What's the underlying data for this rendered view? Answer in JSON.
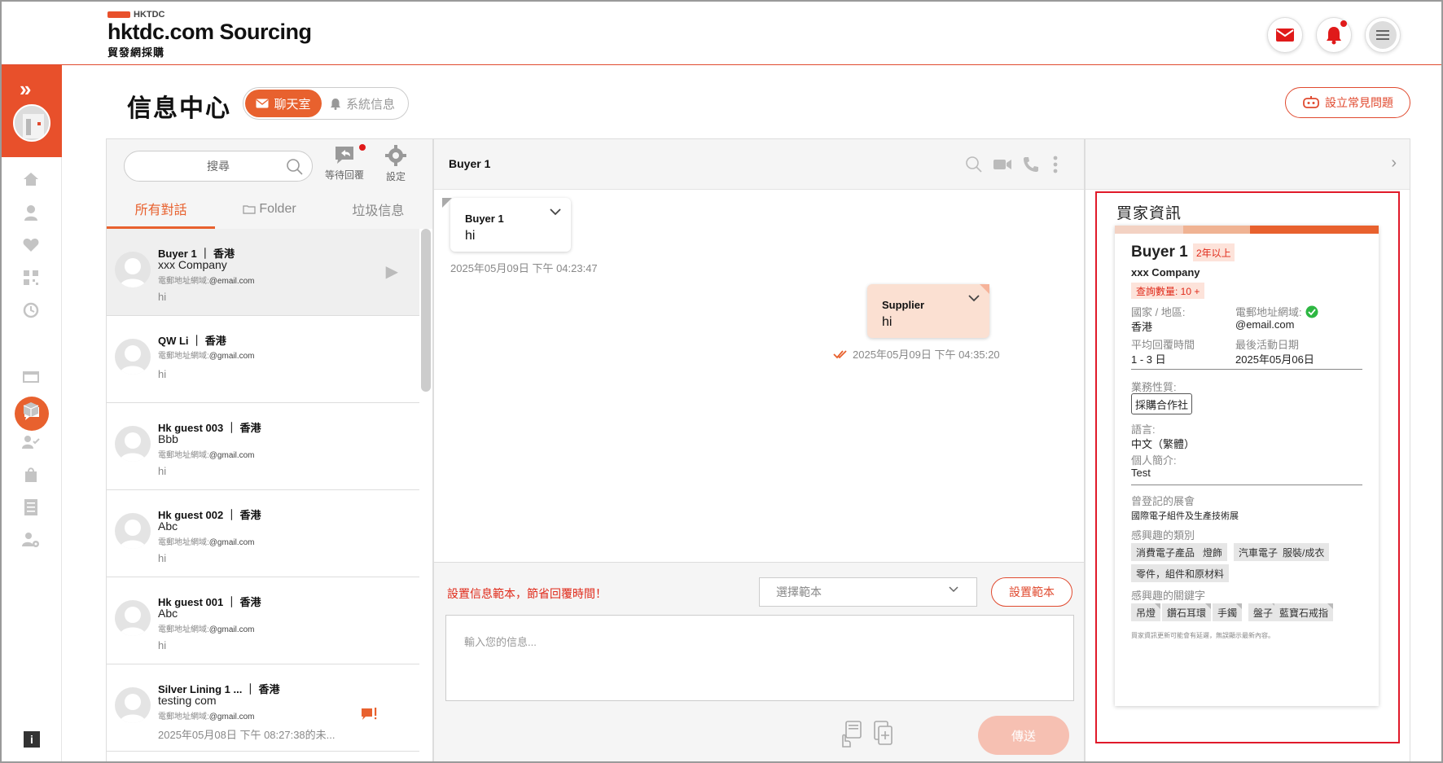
{
  "header": {
    "logo_small": "HKTDC",
    "logo_main": "hktdc.com Sourcing",
    "logo_sub": "貿發網採購"
  },
  "page": {
    "title": "信息中心",
    "tab_chat": "聊天室",
    "tab_system": "系統信息",
    "faq_button": "設立常見問題"
  },
  "list_panel": {
    "search_placeholder": "搜尋",
    "awaiting_reply": "等待回覆",
    "settings": "設定",
    "tabs": [
      "所有對話",
      "Folder",
      "垃圾信息"
    ],
    "email_domain_label": "電郵地址網域:",
    "conversations": [
      {
        "name": "Buyer 1",
        "region": "香港",
        "company": "xxx Company",
        "email": "@email.com",
        "message": "hi"
      },
      {
        "name": "QW Li",
        "region": "香港",
        "company": "",
        "email": "@gmail.com",
        "message": "hi"
      },
      {
        "name": "Hk guest 003",
        "region": "香港",
        "company": "Bbb",
        "email": "@gmail.com",
        "message": "hi"
      },
      {
        "name": "Hk guest 002",
        "region": "香港",
        "company": "Abc",
        "email": "@gmail.com",
        "message": "hi"
      },
      {
        "name": "Hk guest 001",
        "region": "香港",
        "company": "Abc",
        "email": "@gmail.com",
        "message": "hi"
      },
      {
        "name": "Silver Lining 1 ...",
        "region": "香港",
        "company": "testing com",
        "email": "@gmail.com",
        "message": "2025年05月08日 下午 08:27:38的未..."
      }
    ]
  },
  "chat": {
    "title": "Buyer 1",
    "messages": [
      {
        "sender": "Buyer 1",
        "text": "hi",
        "time": "2025年05月09日 下午 04:23:47"
      },
      {
        "sender": "Supplier",
        "text": "hi",
        "time": "2025年05月09日 下午 04:35:20"
      }
    ],
    "template_hint": "設置信息範本，節省回覆時間！",
    "template_select": "選擇範本",
    "template_button": "設置範本",
    "input_placeholder": "輸入您的信息...",
    "send": "傳送"
  },
  "buyer_info": {
    "title": "買家資訊",
    "name": "Buyer 1",
    "years_badge": "2年以上",
    "company": "xxx Company",
    "inquiry_badge": "查詢數量: 10 +",
    "country_label": "國家 / 地區:",
    "country": "香港",
    "email_domain_label": "電郵地址網域:",
    "email_domain": "@email.com",
    "avg_reply_label": "平均回覆時間",
    "avg_reply": "1 - 3 日",
    "last_active_label": "最後活動日期",
    "last_active": "2025年05月06日",
    "business_label": "業務性質:",
    "business": "採購合作社",
    "language_label": "語言:",
    "language": "中文（繁體）",
    "intro_label": "個人簡介:",
    "intro": "Test",
    "fairs_label": "曾登記的展會",
    "fairs": "國際電子組件及生產技術展",
    "interest_cat_label": "感興趣的類別",
    "interest_cats": [
      "消費電子產品",
      "燈飾",
      "汽車電子",
      "服裝/成衣",
      "零件，組件和原材料"
    ],
    "interest_kw_label": "感興趣的關鍵字",
    "interest_kws": [
      "吊燈",
      "鑽石耳環",
      "手鐲",
      "盤子",
      "藍寶石戒指"
    ],
    "footnote": "買家資訊更新可能會有延遲，無誤顯示最新內容。"
  },
  "colors": {
    "brand": "#e8502b",
    "accent": "#e8612e",
    "alert": "#e01a1a"
  }
}
